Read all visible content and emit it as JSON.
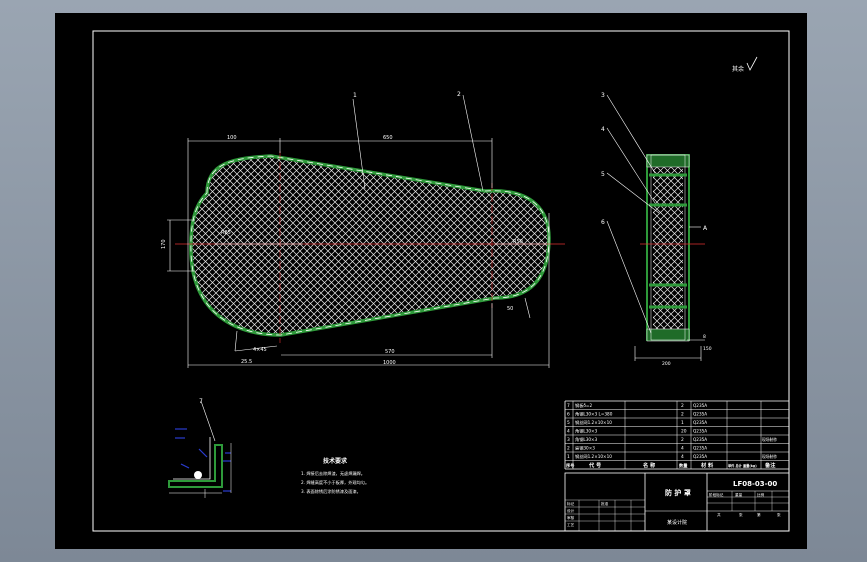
{
  "drawing": {
    "roughness_symbol": "其余",
    "callouts": [
      "1",
      "2",
      "3",
      "4",
      "5",
      "6",
      "7"
    ],
    "section_label": "A",
    "dims": {
      "d_top_left": "100",
      "d_top_mid": "650",
      "d_left_vert": "170",
      "d_r_left": "R85",
      "d_r_right": "R50",
      "d_right_small": "50",
      "d_bottom_left": "4×45",
      "d_bottom_corner": "25.5",
      "d_bottom_mid": "570",
      "d_bottom_total": "1000",
      "d_side_note": "8",
      "d_side_note2": "150",
      "d_side_width": "200"
    }
  },
  "tech_req": {
    "title": "技术要求",
    "lines": [
      "1. 焊接后去除焊渣，无虚焊漏焊。",
      "2. 焊缝高度不小于板厚，外观均匀。",
      "3. 表面除锈后涂防锈漆及面漆。"
    ]
  },
  "bom": {
    "rows": [
      {
        "no": "7",
        "name": "钢板δ=2",
        "qty": "2",
        "material": "Q235A",
        "note": ""
      },
      {
        "no": "6",
        "name": "角钢L30×3  L=380",
        "qty": "2",
        "material": "Q235A",
        "note": ""
      },
      {
        "no": "5",
        "name": "钢丝网1.2×10×10",
        "qty": "1",
        "material": "Q235A",
        "note": ""
      },
      {
        "no": "4",
        "name": "角钢L30×3",
        "qty": "20",
        "material": "Q235A",
        "note": ""
      },
      {
        "no": "3",
        "name": "角钢L30×3",
        "qty": "2",
        "material": "Q235A",
        "note": "现场制作"
      },
      {
        "no": "2",
        "name": "扁钢30×3",
        "qty": "4",
        "material": "Q235A",
        "note": ""
      },
      {
        "no": "1",
        "name": "钢丝网1.2×10×10",
        "qty": "4",
        "material": "Q235A",
        "note": "现场制作"
      }
    ],
    "header": {
      "no": "序号",
      "code": "代 号",
      "name": "名 称",
      "qty": "数量",
      "material": "材 料",
      "weight": "单件 总计 重量(kg)",
      "note": "备注"
    }
  },
  "title_block": {
    "drawing_no": "LF08-03-00",
    "part_name": "防 护 罩",
    "org": "某设计院",
    "sign_rows": [
      "标记",
      "设计",
      "审核",
      "工艺",
      "批准"
    ],
    "stage_header": [
      "阶段标记",
      "重量",
      "比例"
    ],
    "sheet_info": [
      "共",
      "张",
      "第",
      "张"
    ]
  }
}
